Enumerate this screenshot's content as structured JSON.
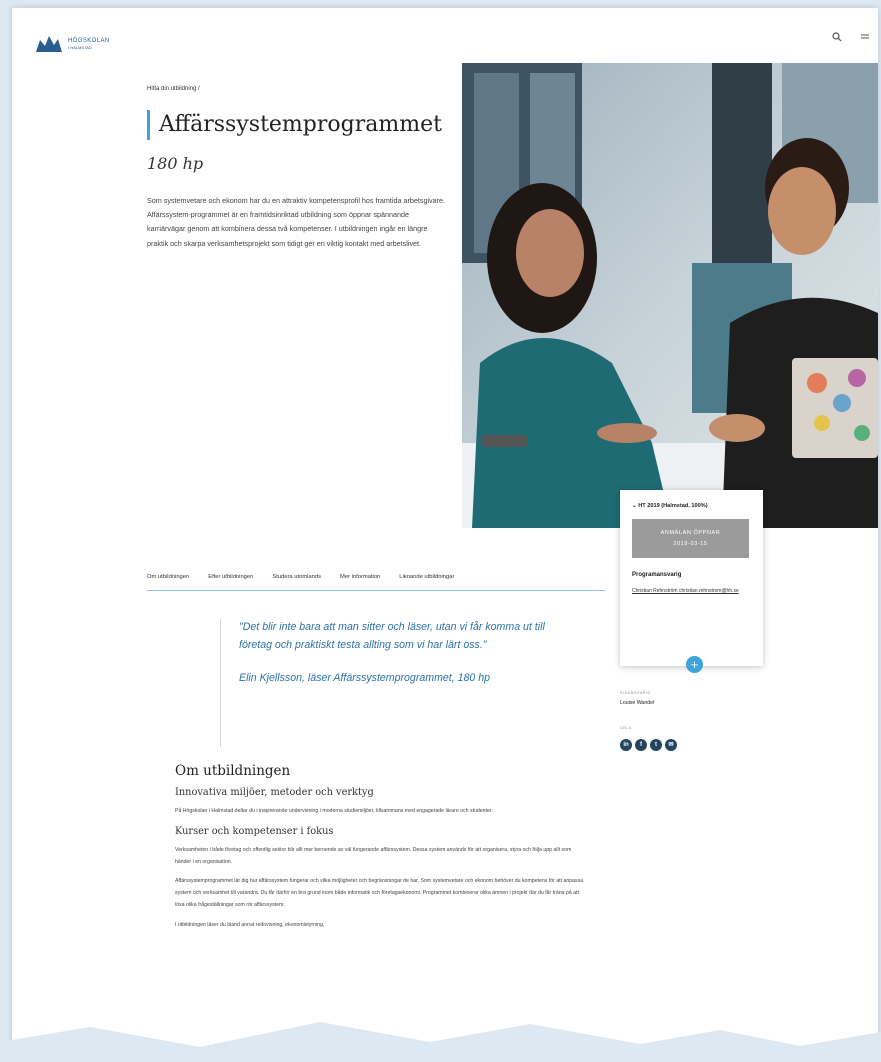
{
  "header": {
    "logo_name": "HÖGSKOLAN",
    "logo_sub": "I HALMSTAD",
    "icons": [
      "search-icon",
      "menu-icon"
    ]
  },
  "breadcrumb": "Hitta din utbildning /",
  "program": {
    "title": "Affärssystemprogrammet",
    "credits": "180 hp",
    "intro": "Som systemvetare och ekonom har du en attraktiv kompetensprofil hos framtida arbetsgivare. Affärssystem-programmet är en framtidsinriktad utbildning som öppnar spännande karriärvägar genom att kombinera dessa två kompetenser. I utbildningen ingår en längre praktik och skarpa verksamhetsprojekt som tidigt ger en viktig kontakt med arbetslivet."
  },
  "side_card": {
    "term": "HT 2019 (Halmstad, 100%)",
    "apply_line1": "ANMÄLAN ÖPPNAR",
    "apply_line2": "2019-03-15",
    "prog_head": "Programansvarig",
    "contact": "Christian Rehnström christian.rehnstrom@hh.se",
    "plus": "+"
  },
  "tabs": [
    "Om utbildningen",
    "Efter utbildningen",
    "Studera utomlands",
    "Mer information",
    "Liknande utbildningar"
  ],
  "quote": {
    "text": "\"Det blir inte bara att man sitter och läser, utan vi får komma ut till företag och praktiskt testa allting som vi har lärt oss.\"",
    "attribution": "Elin Kjellsson, läser Affärssystemprogrammet, 180 hp"
  },
  "meta": {
    "author_label": "SIDANSVARIG",
    "author": "Louise Wandel",
    "share_label": "DELA",
    "share_icons": [
      "in",
      "f",
      "t",
      "✉"
    ]
  },
  "content": {
    "h2": "Om utbildningen",
    "h3_1": "Innovativa miljöer, metoder och verktyg",
    "p1": "På Högskolan i Halmstad deltar du i inspirerande undervisning i moderna studiemiljöer, tillsammans med engagerade lärare och studenter.",
    "h3_2": "Kurser och kompetenser i fokus",
    "p2": "Verksamheten i både företag och offentlig sektor blir allt mer beroende av väl fungerande affärssystem. Dessa system används för att organisera, styra och följa upp allt som händer i en organisation.",
    "p3": "Affärssystemprogrammet lär dig hur affärssystem fungerar och vilka möjligheter och begränsningar de har. Som systemvetare och ekonom behöver du kompetens för att anpassa system och verksamhet till varandra. Du får därför en bra grund inom både informatik och företagsekonomi. Programmet kombinerar olika ämnen i projekt där du får träna på att lösa olika frågeställningar som rör affärssystem.",
    "p4": "I utbildningen läser du bland annat redovisning, ekonomistyrning,"
  }
}
